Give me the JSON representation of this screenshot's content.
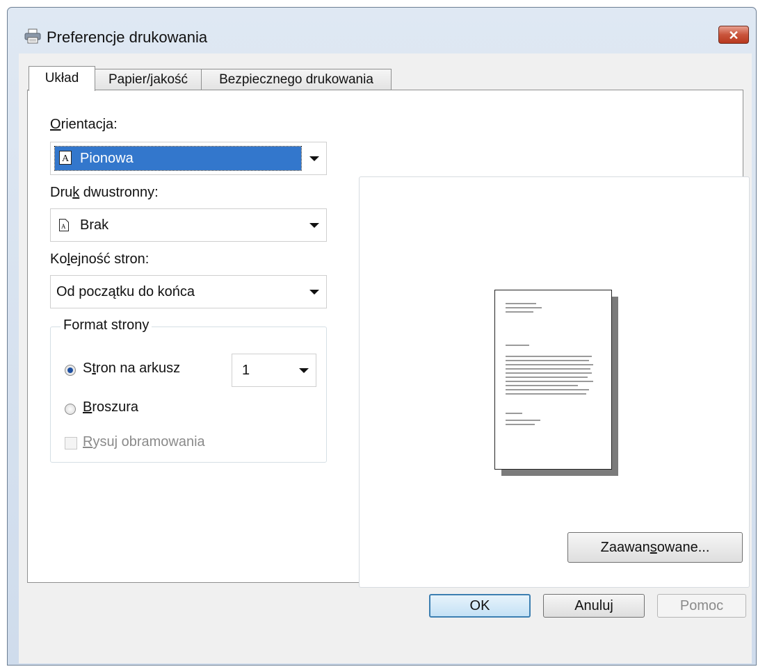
{
  "window": {
    "title": "Preferencje drukowania",
    "close_symbol": "✕"
  },
  "tabs": [
    {
      "label": "Układ",
      "active": true
    },
    {
      "label": "Papier/jakość",
      "active": false
    },
    {
      "label": "Bezpiecznego drukowania",
      "active": false
    }
  ],
  "layout": {
    "orientation": {
      "label_u": "O",
      "label_rest": "rientacja:",
      "value": "Pionowa",
      "icon": "portrait-page-icon"
    },
    "duplex": {
      "label_pre": "Dru",
      "label_u": "k",
      "label_rest": " dwustronny:",
      "value": "Brak",
      "icon": "single-sided-icon"
    },
    "page_order": {
      "label_pre": "Ko",
      "label_u": "l",
      "label_rest": "ejność stron:",
      "value": "Od początku do końca"
    },
    "page_format": {
      "title": "Format strony",
      "pages_per_sheet": {
        "label_pre": "S",
        "label_u": "t",
        "label_rest": "ron na arkusz",
        "checked": true,
        "value": "1"
      },
      "booklet": {
        "label_u": "B",
        "label_rest": "roszura",
        "checked": false
      },
      "draw_borders": {
        "label_u": "R",
        "label_rest": "ysuj obramowania",
        "checked": false,
        "enabled": false
      }
    }
  },
  "buttons": {
    "advanced_pre": "Zaawan",
    "advanced_u": "s",
    "advanced_rest": "owane...",
    "ok": "OK",
    "cancel": "Anuluj",
    "help": "Pomoc"
  },
  "colors": {
    "selection": "#3377cc",
    "close": "#c9543b",
    "default_button": "#3c7fb1"
  }
}
